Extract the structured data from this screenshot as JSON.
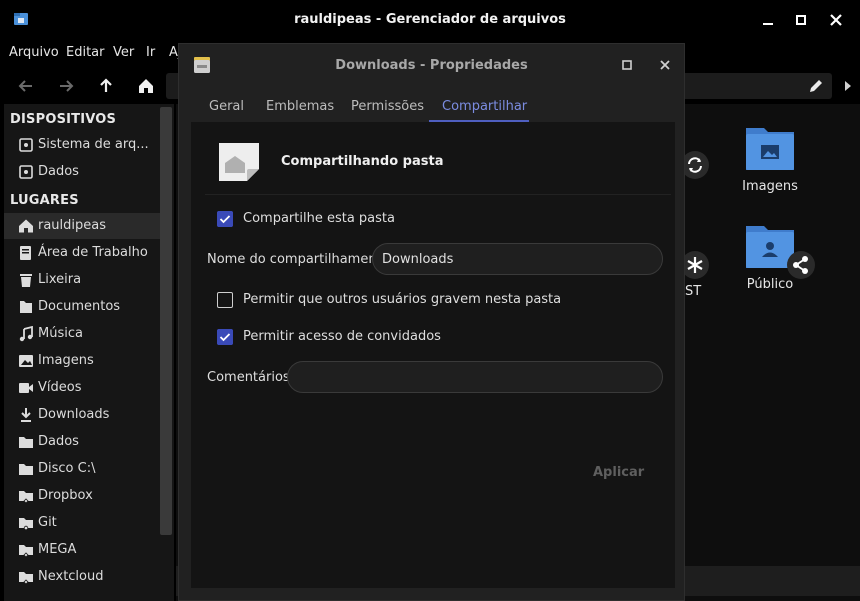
{
  "window": {
    "title": "rauldipeas - Gerenciador de arquivos",
    "minimize_icon": "minimize-icon",
    "maximize_icon": "maximize-icon",
    "close_icon": "close-icon"
  },
  "menu": [
    "Arquivo",
    "Editar",
    "Ver",
    "Ir",
    "Aj"
  ],
  "sidebar": {
    "devices_heading": "DISPOSITIVOS",
    "devices": [
      {
        "label": "Sistema de arq...",
        "icon": "drive-icon"
      },
      {
        "label": "Dados",
        "icon": "drive-icon"
      }
    ],
    "places_heading": "LUGARES",
    "places": [
      {
        "label": "rauldipeas",
        "icon": "home-icon"
      },
      {
        "label": "Área de Trabalho",
        "icon": "desktop-icon"
      },
      {
        "label": "Lixeira",
        "icon": "trash-icon"
      },
      {
        "label": "Documentos",
        "icon": "document-icon"
      },
      {
        "label": "Música",
        "icon": "music-icon"
      },
      {
        "label": "Imagens",
        "icon": "image-icon"
      },
      {
        "label": "Vídeos",
        "icon": "video-icon"
      },
      {
        "label": "Downloads",
        "icon": "download-icon"
      },
      {
        "label": "Dados",
        "icon": "folder-icon"
      },
      {
        "label": "Disco C:\\",
        "icon": "folder-icon"
      },
      {
        "label": "Dropbox",
        "icon": "cloud-folder-icon"
      },
      {
        "label": "Git",
        "icon": "folder-icon"
      },
      {
        "label": "MEGA",
        "icon": "cloud-folder-icon"
      },
      {
        "label": "Nextcloud",
        "icon": "cloud-folder-icon"
      }
    ]
  },
  "files": [
    {
      "label": "Imagens",
      "icon": "pictures-folder-icon"
    },
    {
      "label": "Público",
      "icon": "public-folder-icon"
    },
    {
      "label": "ST",
      "icon": "folder-icon"
    }
  ],
  "dialog": {
    "title": "Downloads - Propriedades",
    "tabs": [
      "Geral",
      "Emblemas",
      "Permissões",
      "Compartilhar"
    ],
    "active_tab": "Compartilhar",
    "heading": "Compartilhando pasta",
    "share_checkbox": {
      "label": "Compartilhe esta pasta",
      "checked": true
    },
    "share_name_label": "Nome do compartilhamento:",
    "share_name_value": "Downloads",
    "write_checkbox": {
      "label": "Permitir que outros usuários gravem nesta pasta",
      "checked": false
    },
    "guest_checkbox": {
      "label": "Permitir acesso de convidados",
      "checked": true
    },
    "comments_label": "Comentários:",
    "comments_value": "",
    "apply_label": "Aplicar"
  },
  "colors": {
    "accent": "#4f5fc0",
    "folder": "#5294e2",
    "background": "#000000"
  }
}
